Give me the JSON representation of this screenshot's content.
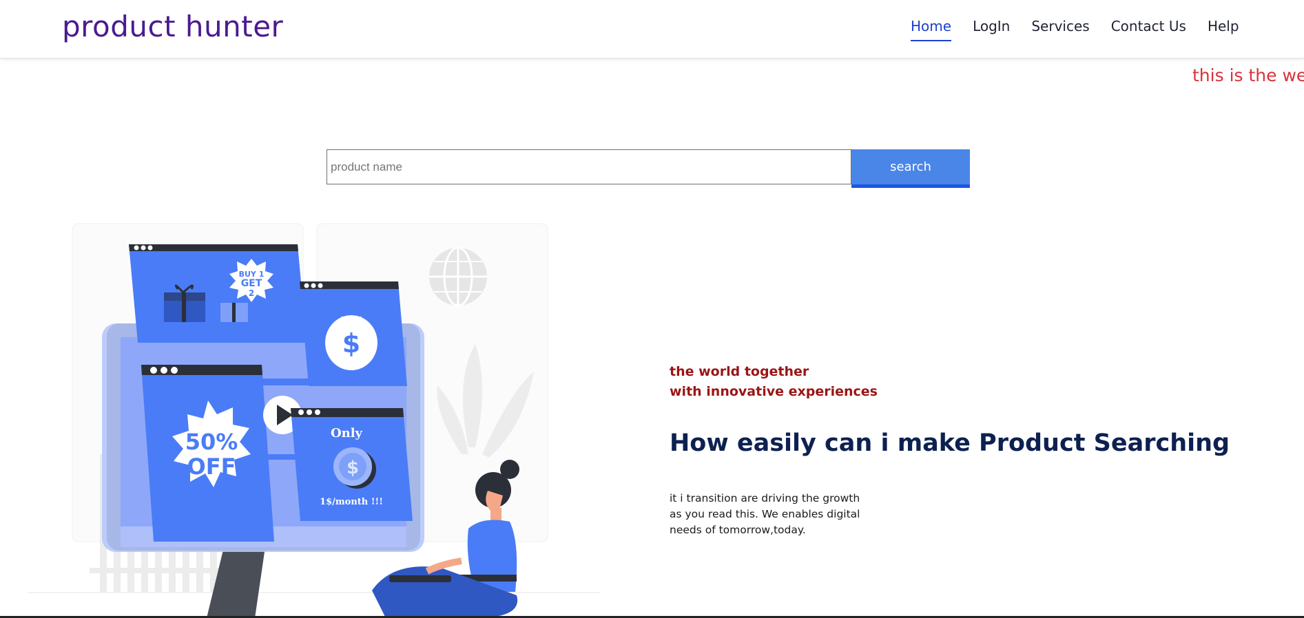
{
  "header": {
    "brand": "product hunter",
    "nav": [
      "Home",
      "LogIn",
      "Services",
      "Contact Us",
      "Help"
    ],
    "active": "Home"
  },
  "marquee": {
    "text": "this is the we"
  },
  "search": {
    "placeholder": "product name",
    "value": "",
    "button": "search"
  },
  "hero": {
    "tagline_line1": "the world together",
    "tagline_line2": "with innovative experiences",
    "headline": "How easily can i make Product Searching",
    "description_lines": [
      "it i transition are driving the growth",
      "as you read this. We enables digital",
      "needs of tomorrow,today."
    ],
    "illustration_text": {
      "promo1": "BUY 1",
      "promo2": "GET",
      "promo3": "2",
      "discount1": "50%",
      "discount2": "OFF",
      "only": "Only",
      "price": "1$/month !!!",
      "money_symbol": "$"
    }
  },
  "colors": {
    "brand": "#4b1a8f",
    "nav_active": "#1a3fd1",
    "marquee": "#d8323b",
    "button": "#4a86e8",
    "tagline": "#9b1515",
    "headline": "#0d2150",
    "illustration_blue": "#4a7cf7"
  }
}
